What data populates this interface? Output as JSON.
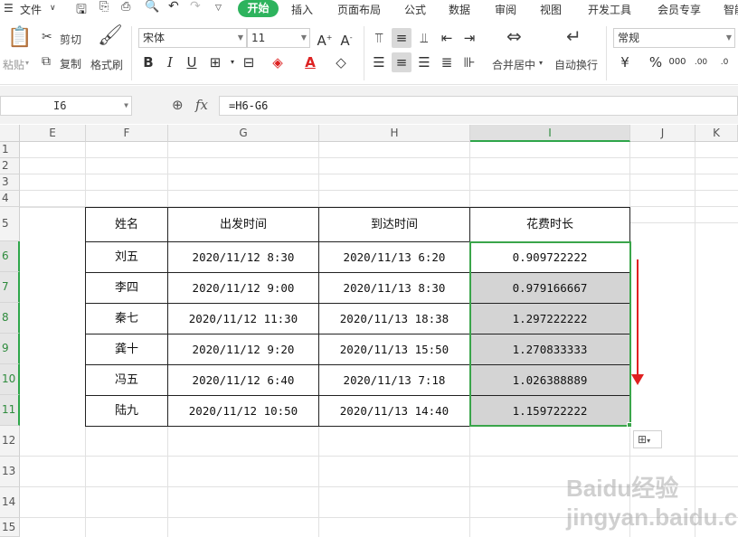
{
  "menubar": {
    "file": "文件",
    "tabs": [
      "开始",
      "插入",
      "页面布局",
      "公式",
      "数据",
      "审阅",
      "视图",
      "开发工具",
      "会员专享",
      "智能"
    ]
  },
  "ribbon": {
    "paste": "粘贴",
    "cut": "剪切",
    "copy": "复制",
    "format_painter": "格式刷",
    "font_name": "宋体",
    "font_size": "11",
    "merge_center": "合并居中",
    "wrap_text": "自动换行",
    "number_format": "常规"
  },
  "formula_bar": {
    "name_box": "I6",
    "fx": "fx",
    "formula": "=H6-G6"
  },
  "columns": [
    "E",
    "F",
    "G",
    "H",
    "I",
    "J",
    "K"
  ],
  "rows": [
    "1",
    "2",
    "3",
    "4",
    "5",
    "6",
    "7",
    "8",
    "9",
    "10",
    "11",
    "12",
    "13",
    "14",
    "15"
  ],
  "table": {
    "headers": [
      "姓名",
      "出发时间",
      "到达时间",
      "花费时长"
    ],
    "rows": [
      [
        "刘五",
        "2020/11/12 8:30",
        "2020/11/13 6:20",
        "0.909722222"
      ],
      [
        "李四",
        "2020/11/12 9:00",
        "2020/11/13 8:30",
        "0.979166667"
      ],
      [
        "秦七",
        "2020/11/12 11:30",
        "2020/11/13 18:38",
        "1.297222222"
      ],
      [
        "龚十",
        "2020/11/12 9:20",
        "2020/11/13 15:50",
        "1.270833333"
      ],
      [
        "冯五",
        "2020/11/12 6:40",
        "2020/11/13 7:18",
        "1.026388889"
      ],
      [
        "陆九",
        "2020/11/12 10:50",
        "2020/11/13 14:40",
        "1.159722222"
      ]
    ]
  },
  "watermark": "Baidu经验 jingyan.baidu.com"
}
